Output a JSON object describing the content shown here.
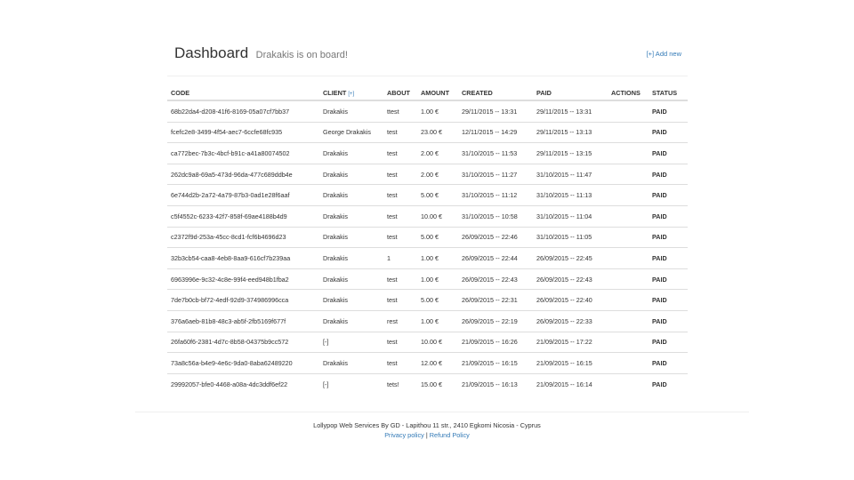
{
  "header": {
    "title": "Dashboard",
    "subtitle": "Drakakis is on board!",
    "add_new": "[+] Add new"
  },
  "table": {
    "columns": {
      "code": "CODE",
      "client": "CLIENT",
      "client_add": "[+]",
      "about": "ABOUT",
      "amount": "AMOUNT",
      "created": "CREATED",
      "paid": "PAID",
      "actions": "ACTIONS",
      "status": "STATUS"
    },
    "rows": [
      {
        "code": "68b22da4-d208-41f6-8169-05a07cf7bb37",
        "client": "Drakakis",
        "about": "ttest",
        "amount": "1.00 €",
        "created": "29/11/2015 -- 13:31",
        "paid": "29/11/2015 -- 13:31",
        "status": "PAID"
      },
      {
        "code": "fcefc2e8-3499-4f54-aec7-6ccfe68fc935",
        "client": "George Drakakis",
        "about": "test",
        "amount": "23.00 €",
        "created": "12/11/2015 -- 14:29",
        "paid": "29/11/2015 -- 13:13",
        "status": "PAID"
      },
      {
        "code": "ca772bec-7b3c-4bcf-b91c-a41a80074502",
        "client": "Drakakis",
        "about": "test",
        "amount": "2.00 €",
        "created": "31/10/2015 -- 11:53",
        "paid": "29/11/2015 -- 13:15",
        "status": "PAID"
      },
      {
        "code": "262dc9a8-69a5-473d-96da-477c689ddb4e",
        "client": "Drakakis",
        "about": "test",
        "amount": "2.00 €",
        "created": "31/10/2015 -- 11:27",
        "paid": "31/10/2015 -- 11:47",
        "status": "PAID"
      },
      {
        "code": "6e744d2b-2a72-4a79-87b3-0ad1e28f6aaf",
        "client": "Drakakis",
        "about": "test",
        "amount": "5.00 €",
        "created": "31/10/2015 -- 11:12",
        "paid": "31/10/2015 -- 11:13",
        "status": "PAID"
      },
      {
        "code": "c5f4552c-6233-42f7-858f-69ae4188b4d9",
        "client": "Drakakis",
        "about": "test",
        "amount": "10.00 €",
        "created": "31/10/2015 -- 10:58",
        "paid": "31/10/2015 -- 11:04",
        "status": "PAID"
      },
      {
        "code": "c2372f9d-253a-45cc-8cd1-fcf6b4696d23",
        "client": "Drakakis",
        "about": "test",
        "amount": "5.00 €",
        "created": "26/09/2015 -- 22:46",
        "paid": "31/10/2015 -- 11:05",
        "status": "PAID"
      },
      {
        "code": "32b3cb54-caa8-4eb8-8aa9-616cf7b239aa",
        "client": "Drakakis",
        "about": "1",
        "amount": "1.00 €",
        "created": "26/09/2015 -- 22:44",
        "paid": "26/09/2015 -- 22:45",
        "status": "PAID"
      },
      {
        "code": "6963996e-9c32-4c8e-99f4-eed948b1fba2",
        "client": "Drakakis",
        "about": "test",
        "amount": "1.00 €",
        "created": "26/09/2015 -- 22:43",
        "paid": "26/09/2015 -- 22:43",
        "status": "PAID"
      },
      {
        "code": "7de7b0cb-bf72-4edf-92d9-374986996cca",
        "client": "Drakakis",
        "about": "test",
        "amount": "5.00 €",
        "created": "26/09/2015 -- 22:31",
        "paid": "26/09/2015 -- 22:40",
        "status": "PAID"
      },
      {
        "code": "376a6aeb-81b8-48c3-ab5f-2fb5169f677f",
        "client": "Drakakis",
        "about": "rest",
        "amount": "1.00 €",
        "created": "26/09/2015 -- 22:19",
        "paid": "26/09/2015 -- 22:33",
        "status": "PAID"
      },
      {
        "code": "26fa60f6-2381-4d7c-8b58-04375b9cc572",
        "client": "[-]",
        "about": "test",
        "amount": "10.00 €",
        "created": "21/09/2015 -- 16:26",
        "paid": "21/09/2015 -- 17:22",
        "status": "PAID"
      },
      {
        "code": "73a8c56a-b4e9-4e6c-9da0-8aba62489220",
        "client": "Drakakis",
        "about": "test",
        "amount": "12.00 €",
        "created": "21/09/2015 -- 16:15",
        "paid": "21/09/2015 -- 16:15",
        "status": "PAID"
      },
      {
        "code": "29992057-bfe0-4468-a08a-4dc3ddf6ef22",
        "client": "[-]",
        "about": "tets!",
        "amount": "15.00 €",
        "created": "21/09/2015 -- 16:13",
        "paid": "21/09/2015 -- 16:14",
        "status": "PAID"
      }
    ]
  },
  "footer": {
    "company": "Lollypop Web Services By GD - Lapithou 11 str., 2410 Egkomi Nicosia - Cyprus",
    "privacy": "Privacy policy",
    "separator": "|",
    "refund": "Refund Policy"
  },
  "colors": {
    "link": "#337ab7",
    "paid": "#109a10",
    "text": "#333333",
    "muted": "#777777",
    "border": "#dddddd"
  }
}
